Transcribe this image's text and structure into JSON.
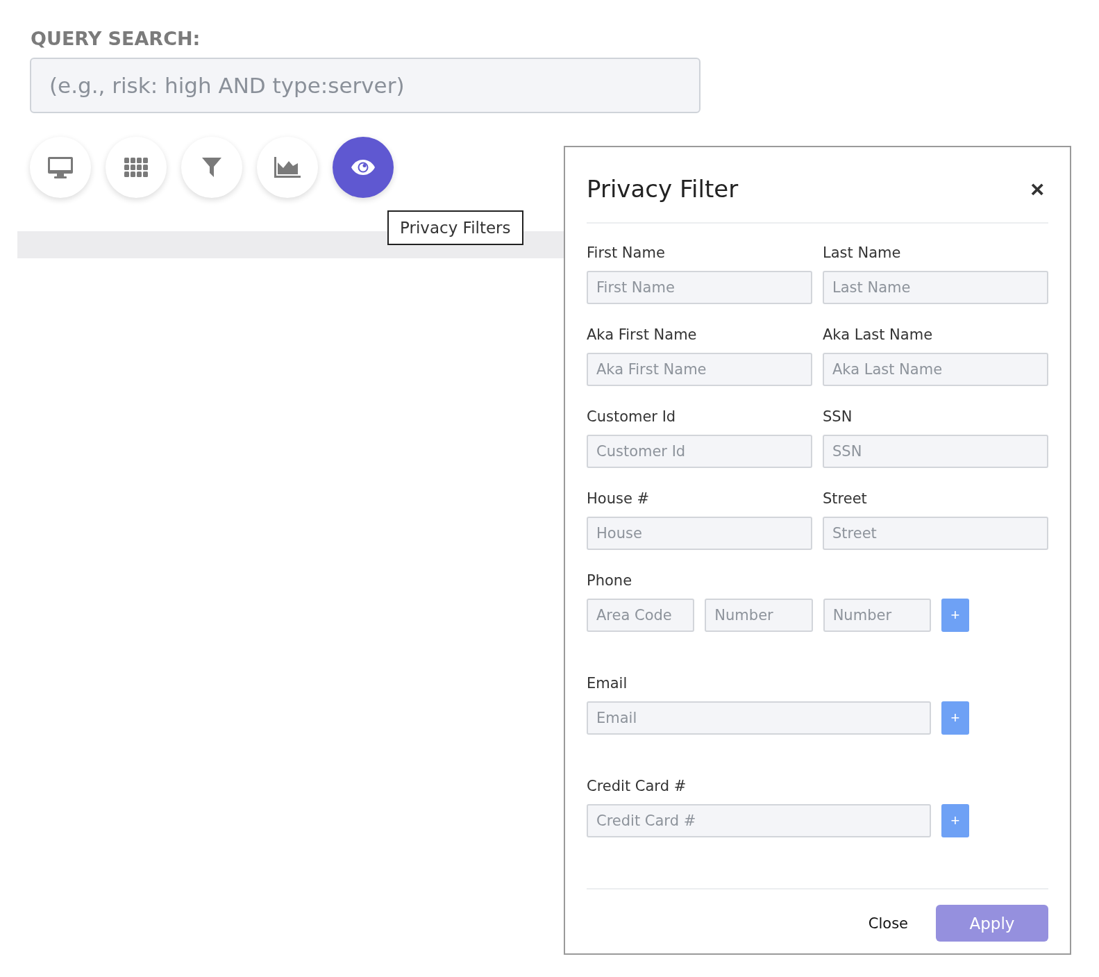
{
  "query": {
    "label": "QUERY SEARCH:",
    "placeholder": "(e.g., risk: high AND type:server)"
  },
  "toolbar": [
    {
      "kind": "monitor",
      "selected": false
    },
    {
      "kind": "grid",
      "selected": false
    },
    {
      "kind": "filter",
      "selected": false
    },
    {
      "kind": "chart",
      "selected": false
    },
    {
      "kind": "eye",
      "selected": true
    }
  ],
  "tooltip": "Privacy Filters",
  "modal": {
    "title": "Privacy Filter",
    "close_icon": "×",
    "groups": [
      {
        "kind": "pair",
        "fields": [
          {
            "label": "First Name",
            "placeholder": "First Name"
          },
          {
            "label": "Last Name",
            "placeholder": "Last Name"
          }
        ]
      },
      {
        "kind": "pair",
        "fields": [
          {
            "label": "Aka First Name",
            "placeholder": "Aka First Name"
          },
          {
            "label": "Aka Last Name",
            "placeholder": "Aka Last Name"
          }
        ]
      },
      {
        "kind": "pair",
        "fields": [
          {
            "label": "Customer Id",
            "placeholder": "Customer Id"
          },
          {
            "label": "SSN",
            "placeholder": "SSN"
          }
        ]
      },
      {
        "kind": "pair",
        "fields": [
          {
            "label": "House #",
            "placeholder": "House"
          },
          {
            "label": "Street",
            "placeholder": "Street"
          }
        ]
      },
      {
        "kind": "multi",
        "label": "Phone",
        "inputs": [
          {
            "placeholder": "Area Code"
          },
          {
            "placeholder": "Number"
          },
          {
            "placeholder": "Number"
          }
        ],
        "add": "+"
      },
      {
        "kind": "multi",
        "label": "Email",
        "inputs": [
          {
            "placeholder": "Email"
          }
        ],
        "add": "+"
      },
      {
        "kind": "multi",
        "label": "Credit Card #",
        "inputs": [
          {
            "placeholder": "Credit Card #"
          }
        ],
        "add": "+"
      }
    ],
    "buttons": {
      "close": "Close",
      "apply": "Apply"
    }
  }
}
